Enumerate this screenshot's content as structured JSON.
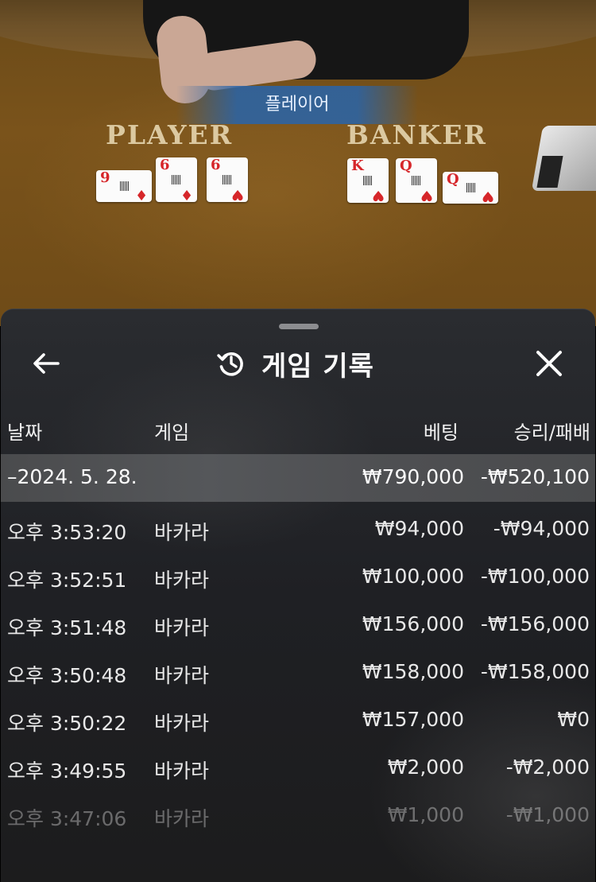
{
  "video": {
    "result_banner": "플레이어",
    "table_words": [
      "PLAYER",
      "BANKER"
    ],
    "player_cards": [
      {
        "rank": "9",
        "suit": "♦"
      },
      {
        "rank": "6",
        "suit": "♦"
      },
      {
        "rank": "6",
        "suit": "♥"
      }
    ],
    "banker_cards": [
      {
        "rank": "K",
        "suit": "♥"
      },
      {
        "rank": "Q",
        "suit": "♥"
      },
      {
        "rank": "Q",
        "suit": "♥"
      }
    ]
  },
  "sheet": {
    "title": "게임 기록",
    "icons": {
      "back": "arrow-left-icon",
      "history": "history-icon",
      "close": "close-icon"
    },
    "columns": {
      "date": "날짜",
      "game": "게임",
      "bet": "베팅",
      "win_loss": "승리/패배"
    },
    "day_summary": {
      "date": "–2024. 5. 28.",
      "bet": "₩790,000",
      "win_loss": "-₩520,100"
    },
    "rows": [
      {
        "time": "오후 3:53:20",
        "game": "바카라",
        "bet": "₩94,000",
        "win_loss": "-₩94,000"
      },
      {
        "time": "오후 3:52:51",
        "game": "바카라",
        "bet": "₩100,000",
        "win_loss": "-₩100,000"
      },
      {
        "time": "오후 3:51:48",
        "game": "바카라",
        "bet": "₩156,000",
        "win_loss": "-₩156,000"
      },
      {
        "time": "오후 3:50:48",
        "game": "바카라",
        "bet": "₩158,000",
        "win_loss": "-₩158,000"
      },
      {
        "time": "오후 3:50:22",
        "game": "바카라",
        "bet": "₩157,000",
        "win_loss": "₩0"
      },
      {
        "time": "오후 3:49:55",
        "game": "바카라",
        "bet": "₩2,000",
        "win_loss": "-₩2,000"
      },
      {
        "time": "오후 3:47:06",
        "game": "바카라",
        "bet": "₩1,000",
        "win_loss": "-₩1,000"
      }
    ]
  }
}
